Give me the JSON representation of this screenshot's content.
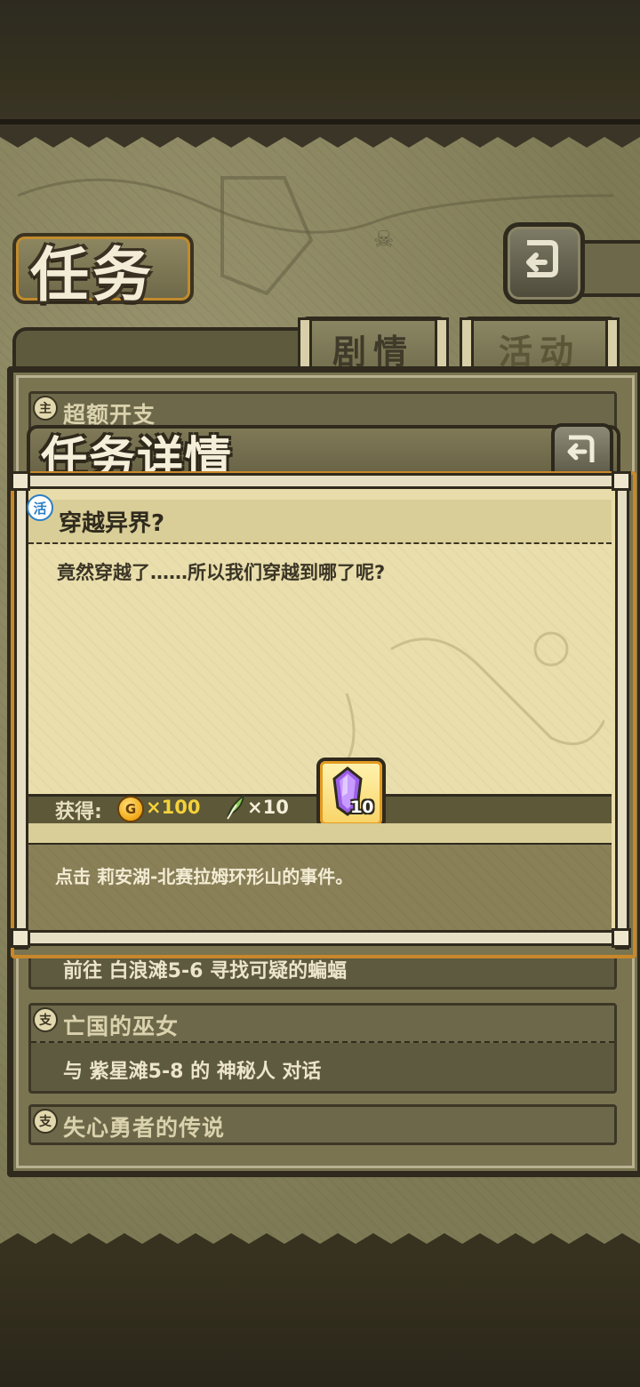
{
  "page": {
    "title": "任务"
  },
  "tabs": [
    {
      "label": "剧情",
      "active": true
    },
    {
      "label": "活动",
      "active": false
    }
  ],
  "quest_list": [
    {
      "badge": "主",
      "title": "超额开支",
      "description": ""
    },
    {
      "badge": "",
      "title": "",
      "description": "前往 白浪滩5-6 寻找可疑的蝙蝠"
    },
    {
      "badge": "支",
      "title": "亡国的巫女",
      "description": "与 紫星滩5-8 的 神秘人 对话"
    },
    {
      "badge": "支",
      "title": "失心勇者的传说",
      "description": ""
    }
  ],
  "modal": {
    "title": "任务详情",
    "quest_badge": "活",
    "quest_title": "穿越异界?",
    "quest_description": "竟然穿越了……所以我们穿越到哪了呢?",
    "reward_label": "获得:",
    "rewards": {
      "gold_symbol": "G",
      "gold_amount": "×100",
      "feather_amount": "×10",
      "crystal_count": "10"
    },
    "condition": "点击 莉安湖-北赛拉姆环形山的事件。"
  },
  "colors": {
    "frame_dark": "#2f2a1d",
    "parchment": "#e8dcaa",
    "accent_orange": "#c8882a",
    "gold_text": "#f5d23a"
  }
}
